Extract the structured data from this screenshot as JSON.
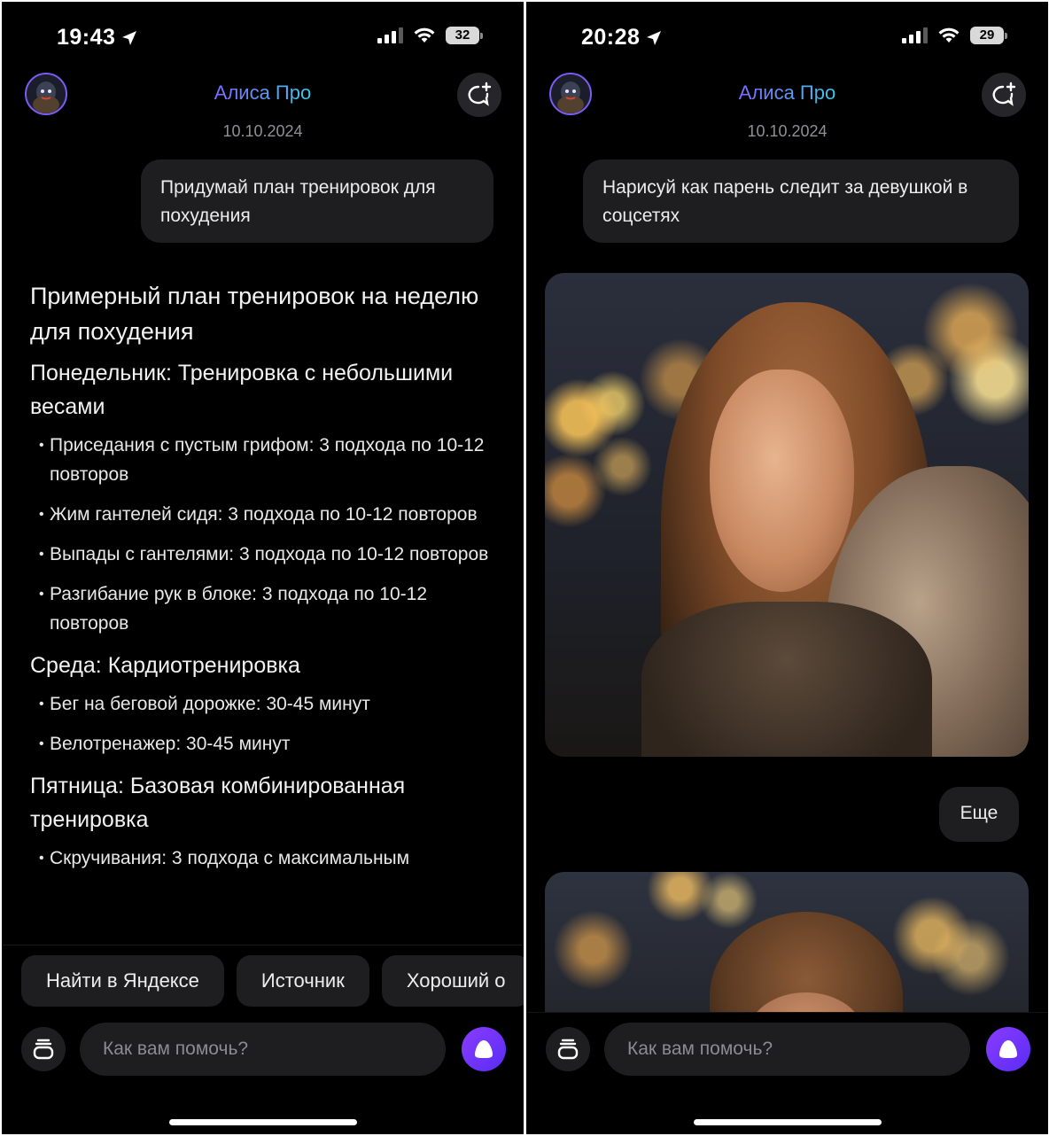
{
  "left": {
    "status": {
      "time": "19:43",
      "battery": "32"
    },
    "header": {
      "title": "Алиса Про",
      "date": "10.10.2024"
    },
    "user_message": "Придумай план тренировок для похудения",
    "response": {
      "title": "Примерный план тренировок на неделю для похудения",
      "sections": [
        {
          "heading": "Понедельник: Тренировка с небольшими весами",
          "items": [
            "Приседания с пустым грифом: 3 подхода по 10-12 повторов",
            "Жим гантелей сидя: 3 подхода по 10-12 повторов",
            "Выпады с гантелями: 3 подхода по 10-12 повторов",
            "Разгибание рук в блоке: 3 подхода по 10-12 повторов"
          ]
        },
        {
          "heading": "Среда: Кардиотренировка",
          "items": [
            "Бег на беговой дорожке: 30-45 минут",
            "Велотренажер: 30-45 минут"
          ]
        },
        {
          "heading": "Пятница: Базовая комбинированная тренировка",
          "items": [
            "Скручивания: 3 подхода с максимальным"
          ]
        }
      ]
    },
    "chips": [
      "Найти в Яндексе",
      "Источник",
      "Хороший о"
    ],
    "input": {
      "placeholder": "Как вам помочь?"
    }
  },
  "right": {
    "status": {
      "time": "20:28",
      "battery": "29"
    },
    "header": {
      "title": "Алиса Про",
      "date": "10.10.2024"
    },
    "user_message": "Нарисуй как парень следит за девушкой в соцсетях",
    "user_message_2": "Еще",
    "input": {
      "placeholder": "Как вам помочь?"
    }
  },
  "icons": {
    "location": "location-arrow-icon",
    "signal": "signal-bars-icon",
    "wifi": "wifi-icon",
    "new_chat": "new-chat-icon",
    "stack": "stack-icon",
    "alice": "alice-icon"
  },
  "colors": {
    "background": "#000000",
    "bubble": "#1e1e21",
    "accent_purple": "#7b3cff",
    "title_gradient_start": "#7b6cff",
    "title_gradient_end": "#3ec6e8",
    "muted_text": "#8f8f95"
  }
}
